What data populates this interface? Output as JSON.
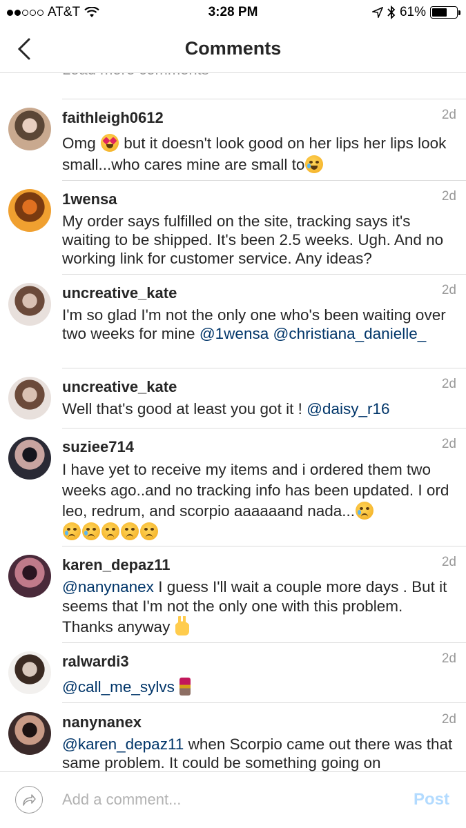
{
  "status_bar": {
    "carrier": "AT&T",
    "time": "3:28 PM",
    "battery": "61%",
    "battery_level": 0.61
  },
  "nav": {
    "title": "Comments"
  },
  "load_more": "Load more comments",
  "comments": [
    {
      "username": "faithleigh0612",
      "time": "2d",
      "avatar": "avatar-faithleigh0612",
      "text": [
        "Omg ",
        {
          "emoji": "heart-eyes"
        },
        " but it doesn't look good on her lips her lips look small...who cares mine are small to",
        {
          "emoji": "laughing-tears"
        }
      ]
    },
    {
      "username": "1wensa",
      "time": "2d",
      "avatar": "avatar-1wensa",
      "text": [
        "My order says fulfilled on the site, tracking says it's waiting to be shipped. It's been 2.5 weeks. Ugh. And no working link for customer service. Any ideas?"
      ]
    },
    {
      "username": "uncreative_kate",
      "time": "2d",
      "avatar": "avatar-uncreative_kate",
      "text": [
        "I'm so glad I'm not the only one who's been waiting over two weeks for mine ",
        {
          "mention": "@1wensa"
        },
        " ",
        {
          "mention": "@christiana_danielle_"
        }
      ]
    },
    {
      "username": "uncreative_kate",
      "time": "2d",
      "avatar": "avatar-uncreative_kate",
      "text": [
        "Well that's good at least you got it ! ",
        {
          "mention": "@daisy_r16"
        }
      ]
    },
    {
      "username": "suziee714",
      "time": "2d",
      "avatar": "avatar-suziee714",
      "text": [
        "I have yet to receive my items and i ordered them two weeks ago..and no tracking info has been updated. I ord leo, redrum, and scorpio aaaaaand nada...",
        {
          "emoji": "crying"
        },
        "\n",
        {
          "emoji": "crying"
        },
        {
          "emoji": "crying"
        },
        {
          "emoji": "pensive"
        },
        {
          "emoji": "pensive"
        },
        {
          "emoji": "pensive"
        }
      ]
    },
    {
      "username": "karen_depaz11",
      "time": "2d",
      "avatar": "avatar-karen_depaz11",
      "text": [
        {
          "mention": "@nanynanex"
        },
        " I guess I'll wait a couple more days . But it seems that I'm not the only one with this problem. Thanks anyway ",
        {
          "emoji": "victory-hand"
        }
      ]
    },
    {
      "username": "ralwardi3",
      "time": "2d",
      "avatar": "avatar-ralwardi3",
      "text": [
        {
          "mention": "@call_me_sylvs"
        },
        " ",
        {
          "emoji": "lipstick"
        }
      ]
    },
    {
      "username": "nanynanex",
      "time": "2d",
      "avatar": "avatar-nanynanex",
      "text": [
        {
          "mention": "@karen_depaz11"
        },
        " when Scorpio came out there was that same problem. It could be something going on"
      ]
    }
  ],
  "composer": {
    "placeholder": "Add a comment...",
    "post_label": "Post"
  },
  "colors": {
    "mention": "#003569",
    "post_disabled": "#b3dbff",
    "divider": "#dbdbdb"
  }
}
